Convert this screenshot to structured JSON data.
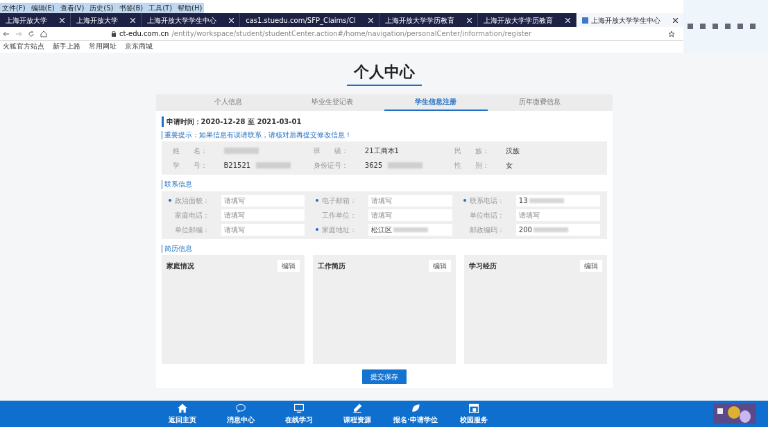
{
  "menu": [
    "文件(F)",
    "编辑(E)",
    "查看(V)",
    "历史(S)",
    "书签(B)",
    "工具(T)",
    "帮助(H)"
  ],
  "browser_tabs": [
    {
      "title": "上海开放大学",
      "selected": false
    },
    {
      "title": "上海开放大学",
      "selected": false
    },
    {
      "title": "上海开放大学学生中心",
      "selected": false
    },
    {
      "title": "cas1.stuedu.com/SFP_Claims/Cl",
      "selected": false
    },
    {
      "title": "上海开放大学学历教育",
      "selected": false
    },
    {
      "title": "上海开放大学学历教育",
      "selected": false
    },
    {
      "title": "上海开放大学学生中心",
      "selected": true
    }
  ],
  "address": {
    "host": "ct-edu.com.cn",
    "url_rest": "/entity/workspace/student/studentCenter.action#/home/navigation/personalCenter/information/register"
  },
  "bookmarks": [
    "火狐官方站点",
    "新手上路",
    "常用网址",
    "京东商城"
  ],
  "page_title": "个人中心",
  "profile_tabs": [
    {
      "label": "个人信息",
      "selected": false
    },
    {
      "label": "毕业生登记表",
      "selected": false
    },
    {
      "label": "学生信息注册",
      "selected": true
    },
    {
      "label": "历年缴费信息",
      "selected": false
    }
  ],
  "period": {
    "label": "申请时间：",
    "value": "2020-12-28 至 2021-03-01"
  },
  "notice": "重要提示：如果信息有误请联系，请核对后再提交修改信息！",
  "basic_info": [
    {
      "label": "姓　　名：",
      "blurred": true
    },
    {
      "label": "班　　级：",
      "value": "21工商本1",
      "blurred": false
    },
    {
      "label": "民　　族：",
      "value": "汉族",
      "blurred": false
    },
    {
      "label": "学　　号：",
      "value": "B21521",
      "blurred": true
    },
    {
      "label": "身份证号：",
      "value": "3625",
      "blurred": true
    },
    {
      "label": "性　　别：",
      "value": "女",
      "blurred": false
    }
  ],
  "contact_title": "联系信息",
  "contact_fields": [
    {
      "label": "政治面貌：",
      "required": true,
      "placeholder": "请填写",
      "blurred": false
    },
    {
      "label": "电子邮箱：",
      "required": true,
      "placeholder": "请填写",
      "blurred": false
    },
    {
      "label": "联系电话：",
      "required": true,
      "value": "13",
      "blurred": true
    },
    {
      "label": "家庭电话：",
      "required": false,
      "placeholder": "请填写",
      "blurred": false
    },
    {
      "label": "工作单位：",
      "required": false,
      "placeholder": "请填写",
      "blurred": false
    },
    {
      "label": "单位电话：",
      "required": false,
      "placeholder": "请填写",
      "blurred": false
    },
    {
      "label": "单位邮编：",
      "required": false,
      "placeholder": "请填写",
      "blurred": false
    },
    {
      "label": "家庭地址：",
      "required": true,
      "value": "松江区",
      "blurred": true
    },
    {
      "label": "邮政编码：",
      "required": false,
      "value": "200",
      "blurred": true
    }
  ],
  "resume_title": "简历信息",
  "resume_cards": [
    {
      "title": "家庭情况",
      "button": "编辑"
    },
    {
      "title": "工作简历",
      "button": "编辑"
    },
    {
      "title": "学习经历",
      "button": "编辑"
    }
  ],
  "submit": "提交保存",
  "bottom_nav": [
    {
      "label": "返回主页",
      "kind": "home"
    },
    {
      "label": "消息中心",
      "kind": "message"
    },
    {
      "label": "在线学习",
      "kind": "monitor"
    },
    {
      "label": "课程资源",
      "kind": "pen"
    },
    {
      "label": "报名·申请学位",
      "kind": "leaf"
    },
    {
      "label": "校园服务",
      "kind": "calendar"
    }
  ]
}
